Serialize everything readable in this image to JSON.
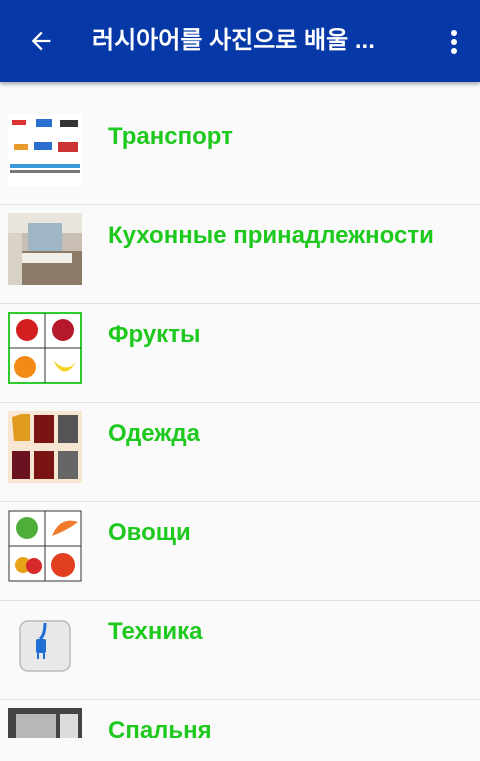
{
  "appbar": {
    "title": "러시아어를 사진으로 배울 ...",
    "back_icon": "arrow-left-icon",
    "menu_icon": "more-vertical-icon",
    "background": "#0638a8"
  },
  "list": {
    "label_color": "#1ec91e",
    "items": [
      {
        "label": "Транспорт",
        "icon": "transport-image"
      },
      {
        "label": "Кухонные принадлежности",
        "icon": "kitchen-image"
      },
      {
        "label": "Фрукты",
        "icon": "fruits-image"
      },
      {
        "label": "Одежда",
        "icon": "clothes-image"
      },
      {
        "label": "Овощи",
        "icon": "vegetables-image"
      },
      {
        "label": "Техника",
        "icon": "plug-image"
      },
      {
        "label": "Спальня",
        "icon": "bedroom-image"
      }
    ]
  }
}
